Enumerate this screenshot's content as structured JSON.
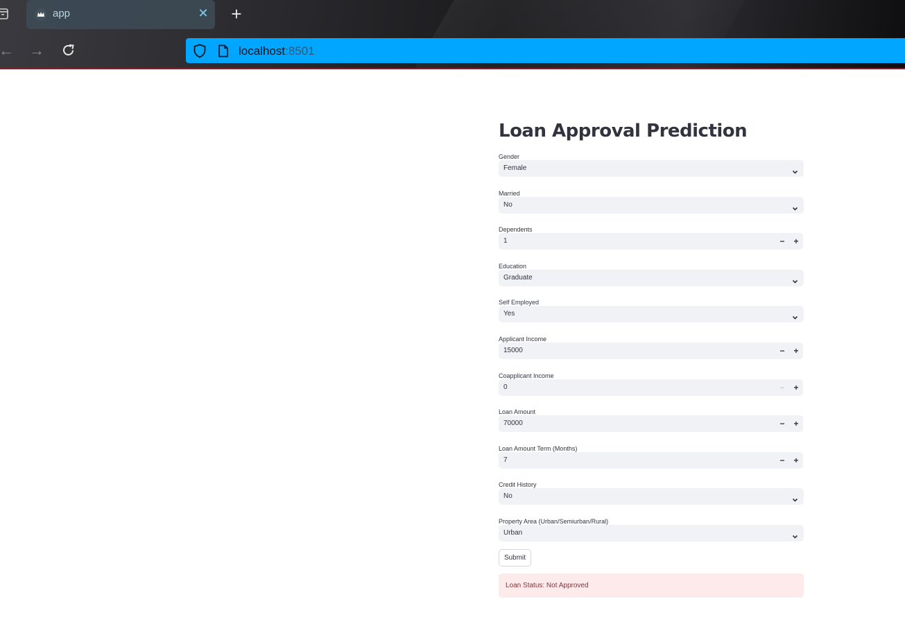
{
  "browser": {
    "tab_title": "app",
    "url_host": "localhost",
    "url_port": ":8501"
  },
  "app": {
    "title": "Loan Approval Prediction",
    "fields": [
      {
        "label": "Gender",
        "type": "select",
        "value": "Female"
      },
      {
        "label": "Married",
        "type": "select",
        "value": "No"
      },
      {
        "label": "Dependents",
        "type": "number",
        "value": "1"
      },
      {
        "label": "Education",
        "type": "select",
        "value": "Graduate"
      },
      {
        "label": "Self Employed",
        "type": "select",
        "value": "Yes"
      },
      {
        "label": "Applicant Income",
        "type": "number",
        "value": "15000"
      },
      {
        "label": "Coapplicant Income",
        "type": "number",
        "value": "0"
      },
      {
        "label": "Loan Amount",
        "type": "number",
        "value": "70000"
      },
      {
        "label": "Loan Amount Term (Months)",
        "type": "number",
        "value": "7"
      },
      {
        "label": "Credit History",
        "type": "select",
        "value": "No"
      },
      {
        "label": "Property Area (Urban/Semiurban/Rural)",
        "type": "select",
        "value": "Urban"
      }
    ],
    "stepper_minus": "−",
    "stepper_plus": "+",
    "submit_label": "Submit",
    "result_text": "Loan Status: Not Approved"
  },
  "colors": {
    "urlbar": "#00a6ff",
    "input_bg": "#f0f2f6",
    "error_bg": "#fdeaea",
    "error_text": "#7d353b",
    "text": "#31333f"
  }
}
